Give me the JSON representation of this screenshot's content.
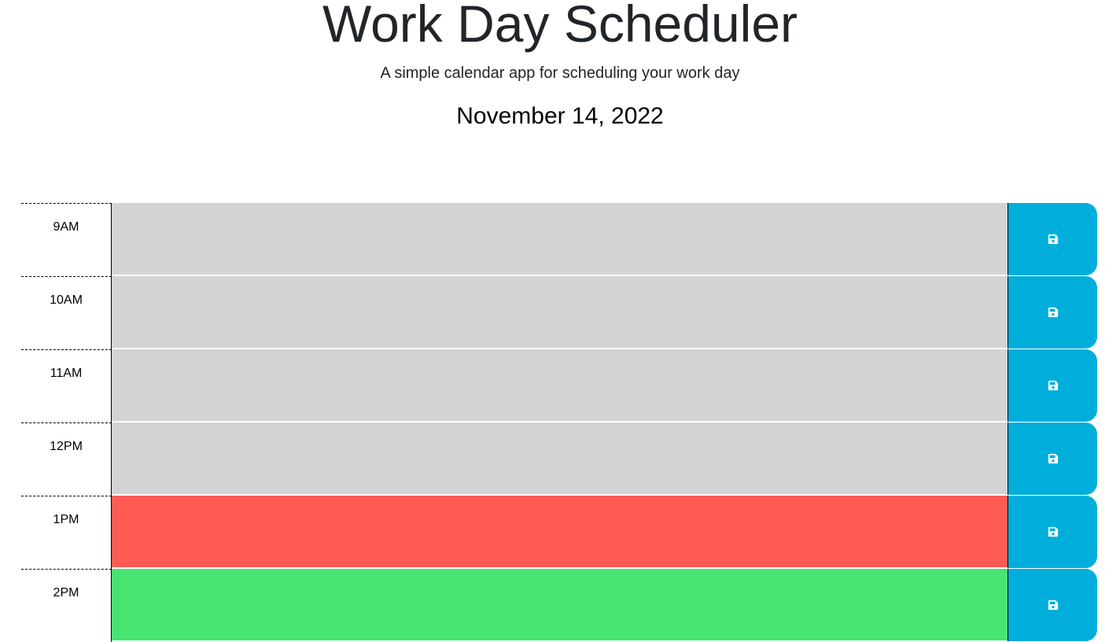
{
  "header": {
    "title": "Work Day Scheduler",
    "subtitle": "A simple calendar app for scheduling your work day",
    "current_date": "November 14, 2022"
  },
  "colors": {
    "past": "#d3d3d3",
    "present": "#ff5b55",
    "future": "#47e472",
    "save_button": "#00aedb"
  },
  "time_blocks": [
    {
      "hour": "9AM",
      "status": "past",
      "description": "",
      "save_icon": "save-icon"
    },
    {
      "hour": "10AM",
      "status": "past",
      "description": "",
      "save_icon": "save-icon"
    },
    {
      "hour": "11AM",
      "status": "past",
      "description": "",
      "save_icon": "save-icon"
    },
    {
      "hour": "12PM",
      "status": "past",
      "description": "",
      "save_icon": "save-icon"
    },
    {
      "hour": "1PM",
      "status": "present",
      "description": "",
      "save_icon": "save-icon"
    },
    {
      "hour": "2PM",
      "status": "future",
      "description": "",
      "save_icon": "save-icon"
    }
  ]
}
